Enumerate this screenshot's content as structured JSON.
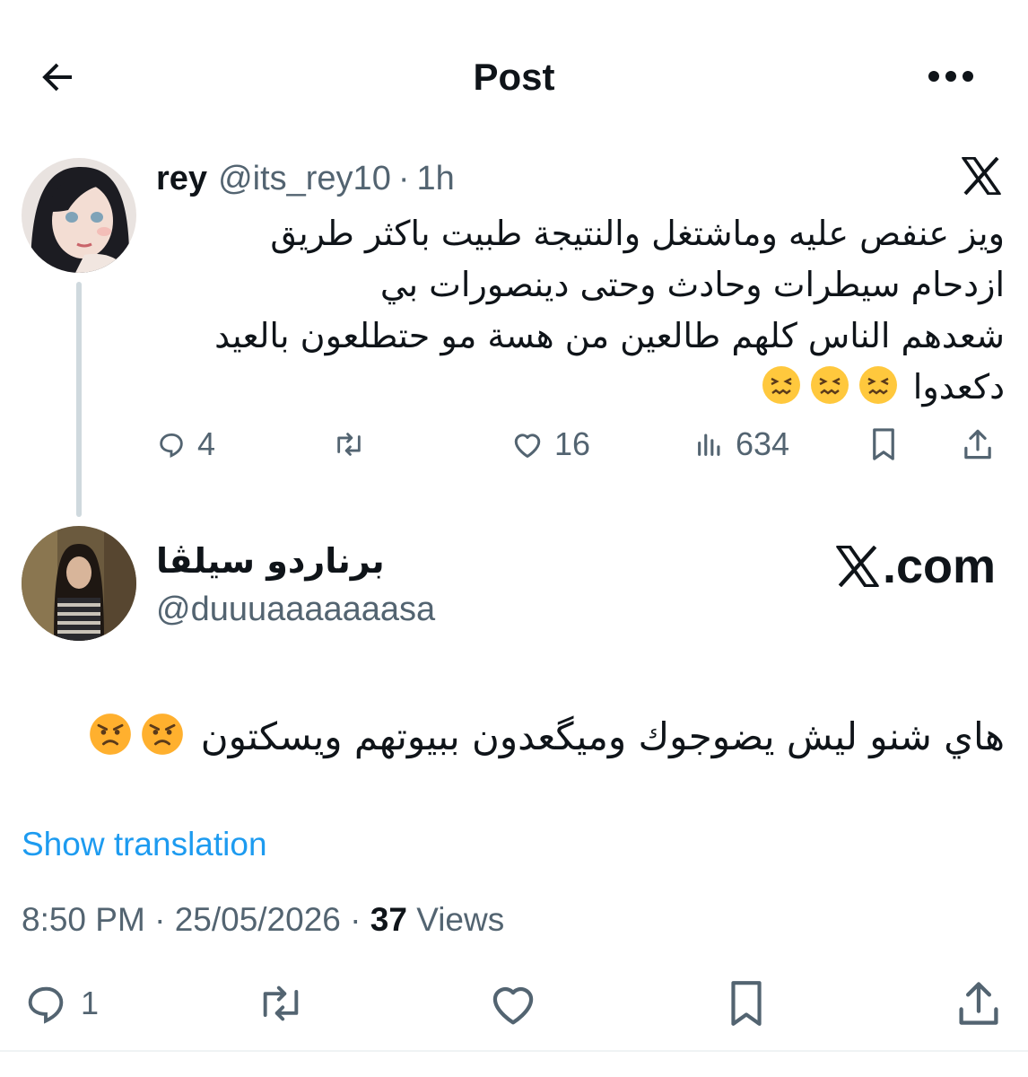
{
  "header": {
    "title": "Post",
    "back_icon": "arrow-left-icon",
    "more_icon": "more-horizontal-icon"
  },
  "parent_post": {
    "display_name": "rey",
    "handle": "@its_rey10",
    "separator": "·",
    "time": "1h",
    "lines": [
      "ويز عنفص عليه وماشتغل والنتيجة طبيت باكثر طريق",
      "ازدحام سيطرات وحادث وحتى دينصورات بي",
      "شعدهم الناس كلهم طالعين من هسة مو حتطلعون بالعيد",
      "دكعدوا"
    ],
    "emojis": [
      "confounded-face",
      "confounded-face",
      "confounded-face"
    ],
    "stats": {
      "replies": "4",
      "likes": "16",
      "views": "634"
    }
  },
  "reply_post": {
    "display_name": "برناردو سيلڤا",
    "handle": "@duuuaaaaaaasa",
    "source_label": ".com",
    "text": "هاي شنو ليش يضوجوك وميگعدون ببيوتهم ويسكتون",
    "emojis": [
      "angry-face",
      "angry-face"
    ],
    "show_translation": "Show translation",
    "time": "8:50 PM",
    "date": "25/05/2026",
    "meta_separator": "·",
    "views_count": "37",
    "views_label": "Views",
    "stats": {
      "replies": "1"
    }
  },
  "colors": {
    "text": "#0f1419",
    "secondary": "#536471",
    "link": "#1d9bf0",
    "divider": "#cfd9de"
  }
}
